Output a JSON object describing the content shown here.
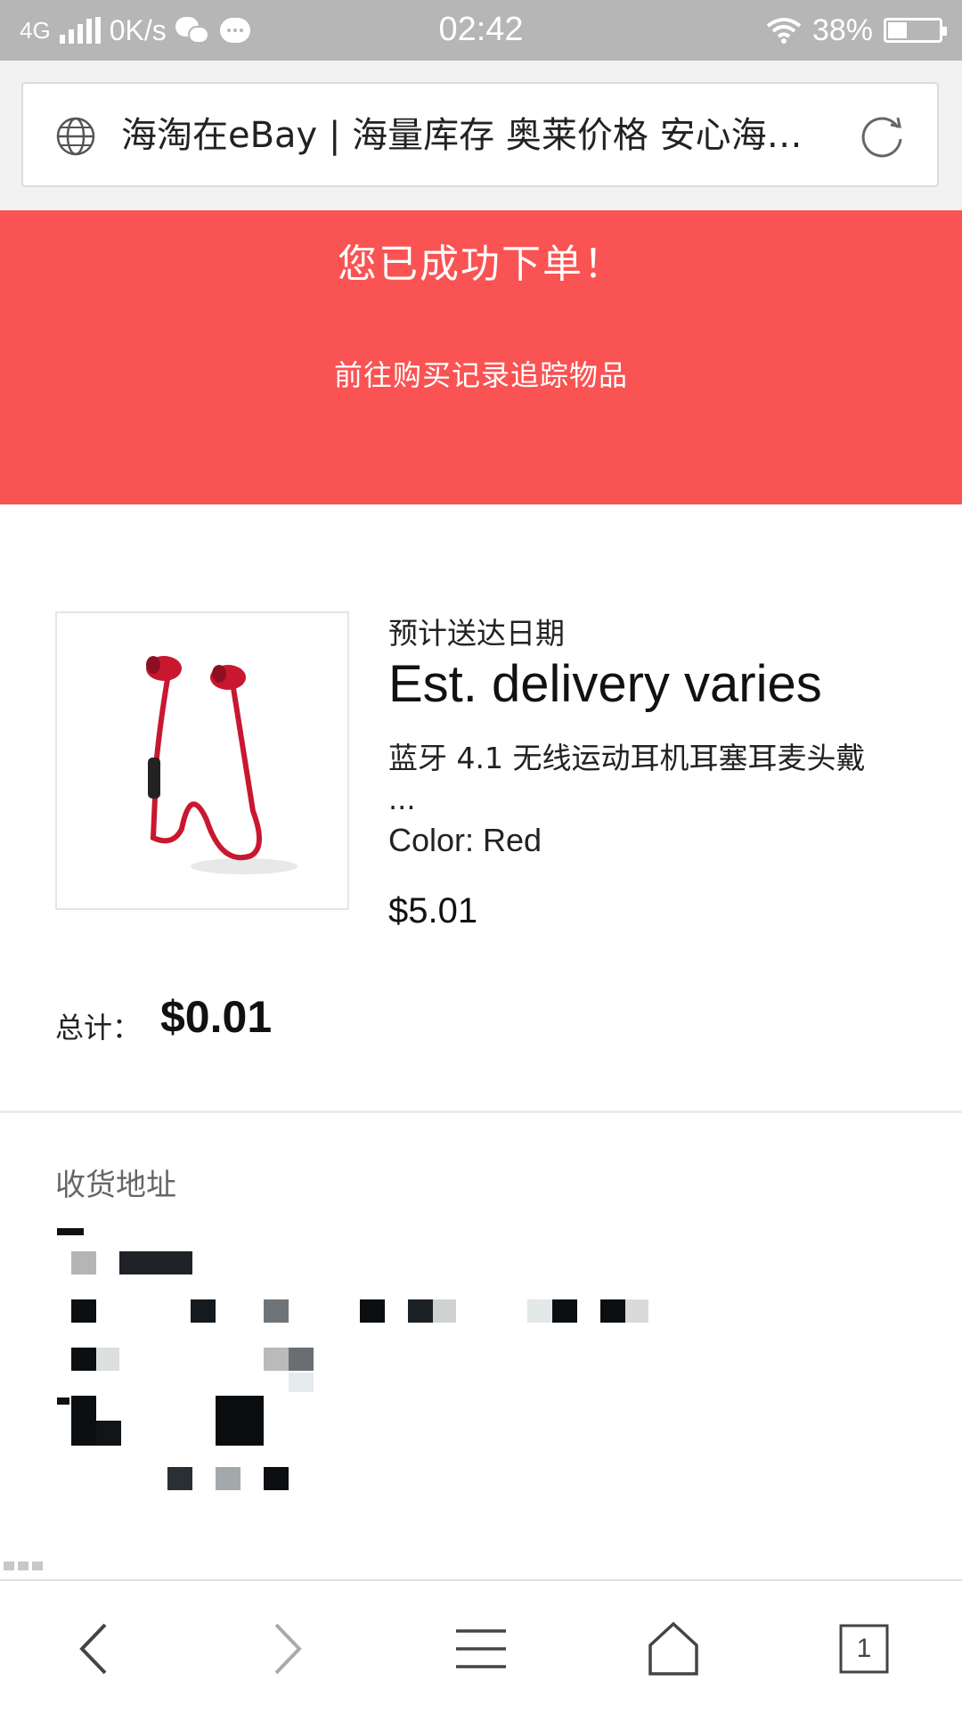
{
  "status_bar": {
    "network": "4G",
    "speed": "0K/s",
    "time": "02:42",
    "battery": "38%",
    "battery_level": 0.38
  },
  "browser": {
    "page_title": "海淘在eBay | 海量库存 奥莱价格 安心海…"
  },
  "banner": {
    "title": "您已成功下单！",
    "track_link": "前往购买记录追踪物品",
    "color": "#f95353"
  },
  "order": {
    "delivery_label": "预计送达日期",
    "delivery_value": "Est. delivery varies",
    "item_title": "蓝牙 4.1 无线运动耳机耳塞耳麦头戴",
    "item_title_more": "...",
    "item_color": "Color: Red",
    "item_price": "$5.01",
    "total_label": "总计：",
    "total_value": "$0.01"
  },
  "address": {
    "heading": "收货地址"
  },
  "bottom_nav": {
    "tab_count": "1"
  },
  "icons": [
    "globe-icon",
    "refresh-icon",
    "back-icon",
    "forward-icon",
    "menu-icon",
    "home-icon",
    "tabs-icon",
    "wifi-icon",
    "battery-icon",
    "wechat-icon",
    "message-icon"
  ]
}
